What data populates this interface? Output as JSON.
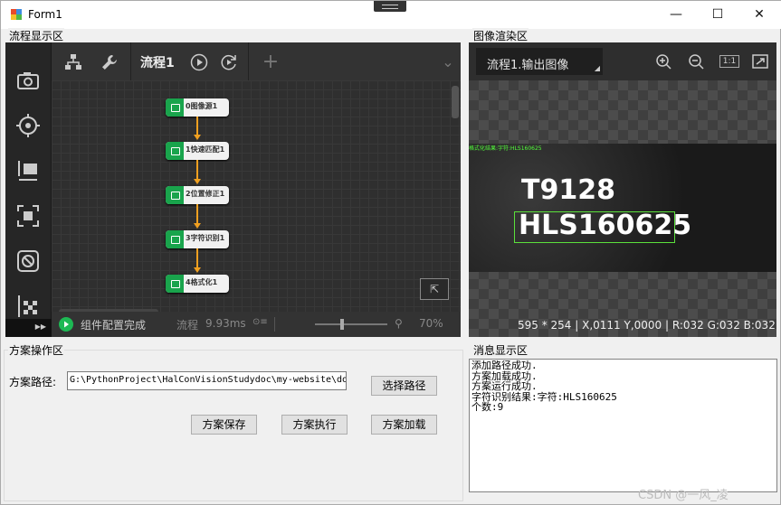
{
  "window": {
    "title": "Form1",
    "min_glyph": "—",
    "max_glyph": "☐",
    "close_glyph": "✕"
  },
  "groups": {
    "flow_label": "流程显示区",
    "image_label": "图像渲染区",
    "ops_label": "方案操作区",
    "message_label": "消息显示区"
  },
  "flow": {
    "tab_title": "流程1",
    "add_glyph": "+",
    "chevron": "⌄",
    "nodes": [
      "0图像源1",
      "1快速匹配1",
      "2位置修正1",
      "3字符识别1",
      "4格式化1"
    ],
    "status_text": "组件配置完成",
    "timing_label": "流程",
    "timing_value": "9.93ms",
    "zoom_value": "70%"
  },
  "image": {
    "title": "流程1.输出图像",
    "result_overlay": "格式化结果:字符:HLS160625",
    "line1": "T9128",
    "line2": "HLS160625",
    "status": "595 * 254  |  X,0111  Y,0000  |  R:032  G:032  B:032",
    "ratio_label": "1:1"
  },
  "ops": {
    "path_label": "方案路径:",
    "path_value": "G:\\PythonProject\\HalConVisionStudydoc\\my-website\\do",
    "choose_path": "选择路径",
    "save": "方案保存",
    "run": "方案执行",
    "load": "方案加载"
  },
  "messages": [
    "添加路径成功.",
    "方案加载成功.",
    "方案运行成功.",
    "字符识别结果:字符:HLS160625",
    "个数:9"
  ],
  "watermark": "CSDN @一风_凌"
}
